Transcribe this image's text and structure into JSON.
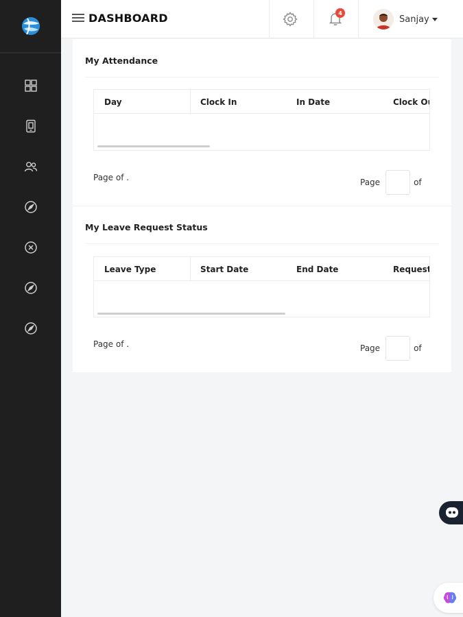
{
  "header": {
    "title": "DASHBOARD",
    "notification_count": "4",
    "user_name": "Sanjay"
  },
  "sidebar": {
    "items": [
      {
        "icon": "dashboard-grid-icon"
      },
      {
        "icon": "device-icon"
      },
      {
        "icon": "users-icon"
      },
      {
        "icon": "compass-icon"
      },
      {
        "icon": "close-circle-icon"
      },
      {
        "icon": "compass-icon"
      },
      {
        "icon": "compass-icon"
      }
    ]
  },
  "attendance": {
    "title": "My Attendance",
    "columns": [
      "Day",
      "Clock In",
      "In Date",
      "Clock Out"
    ],
    "rows": [],
    "page_info": "Page of .",
    "pager_label": "Page",
    "pager_of": "of",
    "scroll_progress": 0.34
  },
  "leave": {
    "title": "My Leave Request Status",
    "columns": [
      "Leave Type",
      "Start Date",
      "End Date",
      "Request"
    ],
    "rows": [],
    "page_info": "Page of .",
    "pager_label": "Page",
    "pager_of": "of",
    "scroll_progress": 0.57
  },
  "colors": {
    "sidebar_bg": "#1f1f1f",
    "badge": "#e84a3a",
    "page_bg": "#f4f5f7"
  }
}
